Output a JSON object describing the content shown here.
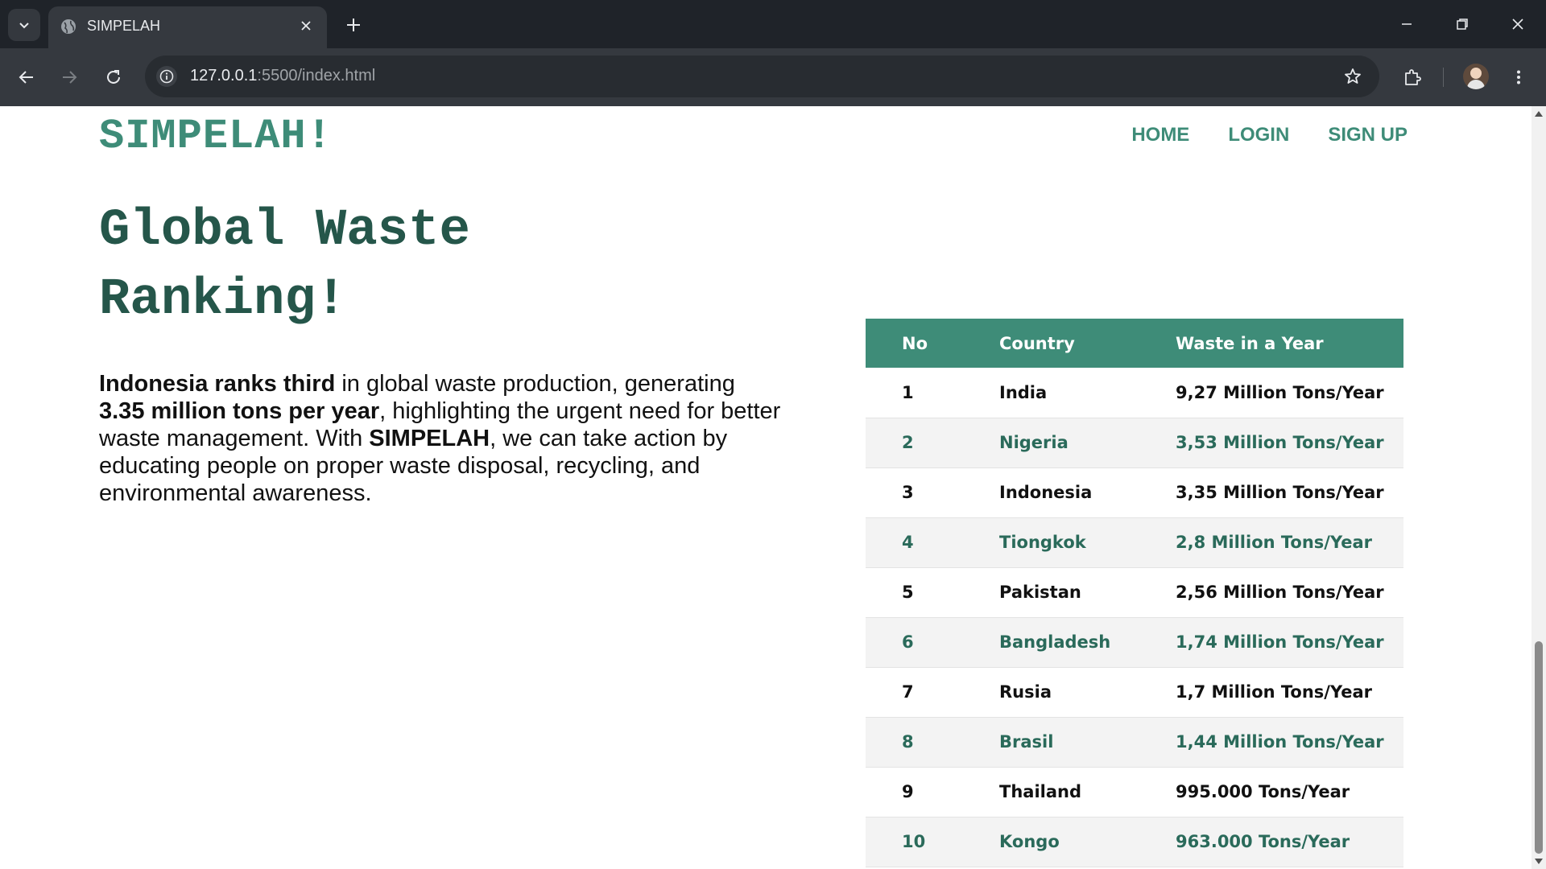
{
  "browser": {
    "tab_title": "SIMPELAH",
    "url_host": "127.0.0.1",
    "url_rest": ":5500/index.html"
  },
  "site": {
    "logo": "SIMPELAH!",
    "nav": [
      "HOME",
      "LOGIN",
      "SIGN UP"
    ]
  },
  "hero": {
    "title_line1": "Global Waste",
    "title_line2": "Ranking!",
    "p1_bold": "Indonesia ranks third",
    "p1_text": " in global waste production, generating ",
    "p2_bold": "3.35 million tons per year",
    "p2_text": ", highlighting the urgent need for better waste management. With ",
    "p3_bold": "SIMPELAH",
    "p3_text": ", we can take action by educating people on proper waste disposal, recycling, and environmental awareness."
  },
  "table": {
    "headers": [
      "No",
      "Country",
      "Waste in a Year"
    ],
    "rows": [
      [
        "1",
        "India",
        "9,27 Million Tons/Year"
      ],
      [
        "2",
        "Nigeria",
        "3,53 Million Tons/Year"
      ],
      [
        "3",
        "Indonesia",
        "3,35 Million Tons/Year"
      ],
      [
        "4",
        "Tiongkok",
        "2,8 Million Tons/Year"
      ],
      [
        "5",
        "Pakistan",
        "2,56 Million Tons/Year"
      ],
      [
        "6",
        "Bangladesh",
        "1,74 Million Tons/Year"
      ],
      [
        "7",
        "Rusia",
        "1,7 Million Tons/Year"
      ],
      [
        "8",
        "Brasil",
        "1,44 Million Tons/Year"
      ],
      [
        "9",
        "Thailand",
        "995.000 Tons/Year"
      ],
      [
        "10",
        "Kongo",
        "963.000 Tons/Year"
      ]
    ]
  },
  "colors": {
    "accent": "#3e8c78",
    "heading": "#25564a",
    "even_row_text": "#2a6a5a"
  }
}
